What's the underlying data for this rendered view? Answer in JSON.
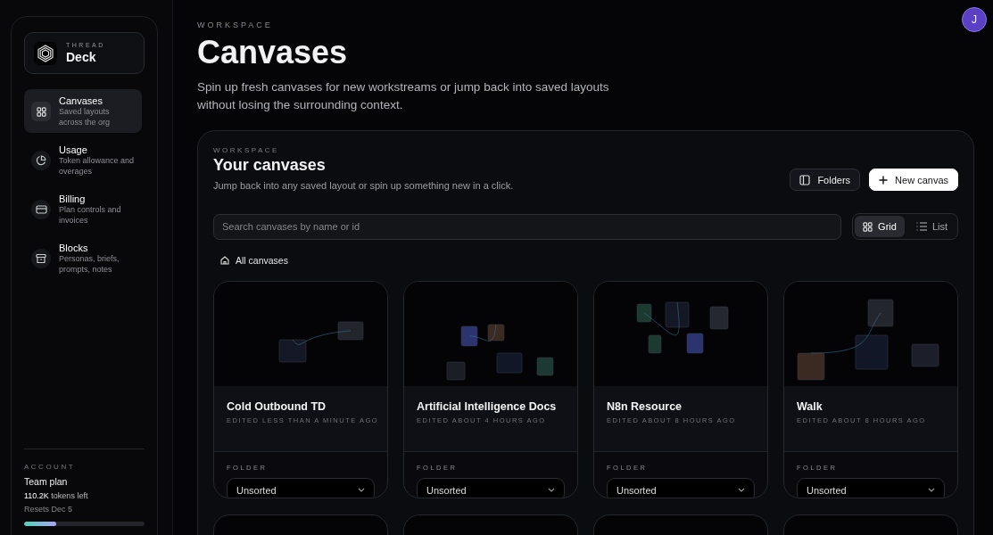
{
  "brand": {
    "eyebrow": "THREAD",
    "name": "Deck"
  },
  "nav": [
    {
      "kind": "canvases",
      "title": "Canvases",
      "subtitle": "Saved layouts across the org",
      "selected": true
    },
    {
      "kind": "usage",
      "title": "Usage",
      "subtitle": "Token allowance and overages",
      "selected": false
    },
    {
      "kind": "billing",
      "title": "Billing",
      "subtitle": "Plan controls and invoices",
      "selected": false
    },
    {
      "kind": "blocks",
      "title": "Blocks",
      "subtitle": "Personas, briefs, prompts, notes",
      "selected": false
    }
  ],
  "account": {
    "label": "ACCOUNT",
    "plan": "Team plan",
    "tokens": "**110.2K** tokens left",
    "resets": "Resets Dec 5",
    "level": 0.27
  },
  "user": {
    "initial": "J"
  },
  "header": {
    "eyebrow": "WORKSPACE",
    "title": "Canvases",
    "description": "Spin up fresh canvases for new workstreams or jump back into saved layouts without losing the surrounding context."
  },
  "panel": {
    "eyebrow": "WORKSPACE",
    "title": "Your canvases",
    "description": "Jump back into any saved layout or spin up something new in a click.",
    "buttons": [
      {
        "kind": "folders",
        "label": "Folders"
      },
      {
        "kind": "new",
        "label": "New canvas"
      }
    ],
    "search": {
      "placeholder": "Search canvases by name or id"
    },
    "views": [
      {
        "kind": "grid",
        "label": "Grid",
        "selected": true
      },
      {
        "kind": "list",
        "label": "List",
        "selected": false
      }
    ],
    "breadcrumb": "All canvases",
    "cards": [
      {
        "title": "Cold Outbound TD",
        "edited": "EDITED LESS THAN A MINUTE AGO",
        "folder_label": "FOLDER",
        "folder": "Unsorted"
      },
      {
        "title": "Artificial Intelligence Docs",
        "edited": "EDITED ABOUT 4 HOURS AGO",
        "folder_label": "FOLDER",
        "folder": "Unsorted"
      },
      {
        "title": "N8n Resource",
        "edited": "EDITED ABOUT 8 HOURS AGO",
        "folder_label": "FOLDER",
        "folder": "Unsorted"
      },
      {
        "title": "Walk",
        "edited": "EDITED ABOUT 8 HOURS AGO",
        "folder_label": "FOLDER",
        "folder": "Unsorted"
      }
    ]
  }
}
